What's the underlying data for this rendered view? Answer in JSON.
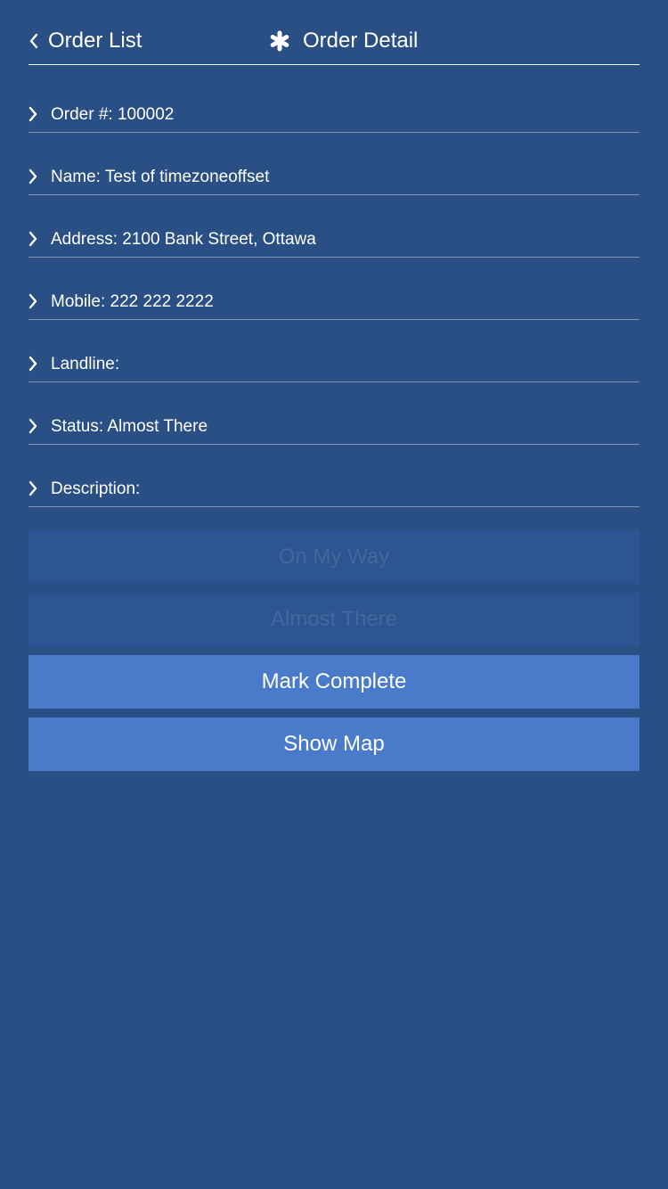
{
  "header": {
    "back_label": "Order List",
    "title": "Order Detail",
    "back_icon": "chevron-left-icon",
    "title_icon": "asterisk-icon"
  },
  "order": {
    "rows": [
      {
        "label": "Order #: 100002"
      },
      {
        "label": "Name: Test of timezoneoffset"
      },
      {
        "label": "Address: 2100 Bank Street, Ottawa"
      },
      {
        "label": "Mobile: 222 222 2222"
      },
      {
        "label": "Landline:"
      },
      {
        "label": "Status: Almost There"
      },
      {
        "label": "Description:"
      }
    ]
  },
  "actions": {
    "on_my_way": "On My Way",
    "almost_there": "Almost There",
    "mark_complete": "Mark Complete",
    "show_map": "Show Map"
  },
  "colors": {
    "background": "#2a4f84",
    "button_enabled": "#4a7bcb",
    "button_disabled": "#2c5591",
    "text": "#ffffff"
  }
}
